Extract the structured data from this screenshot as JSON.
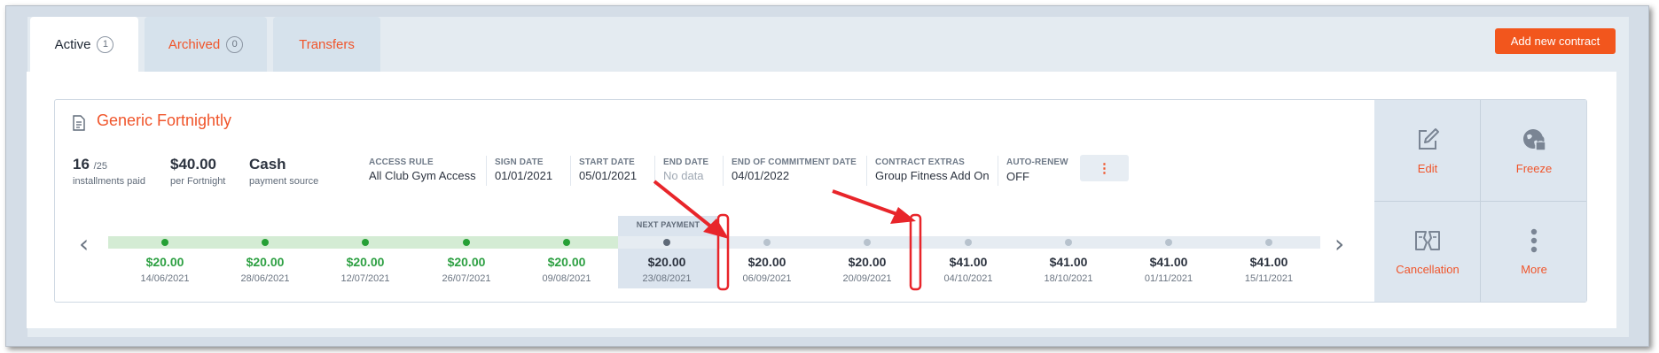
{
  "tabs": [
    {
      "label": "Active",
      "count": "1"
    },
    {
      "label": "Archived",
      "count": "0"
    },
    {
      "label": "Transfers"
    }
  ],
  "add_contract_label": "Add new contract",
  "contract": {
    "title": "Generic Fortnightly",
    "installments": {
      "value": "16",
      "total": "/25",
      "label": "installments paid"
    },
    "price": {
      "value": "$40.00",
      "label": "per Fortnight"
    },
    "payment": {
      "value": "Cash",
      "label": "payment source"
    },
    "fields": [
      {
        "label": "ACCESS RULE",
        "value": "All Club Gym Access"
      },
      {
        "label": "SIGN DATE",
        "value": "01/01/2021"
      },
      {
        "label": "START DATE",
        "value": "05/01/2021"
      },
      {
        "label": "END DATE",
        "value": "No data"
      },
      {
        "label": "END OF COMMITMENT DATE",
        "value": "04/01/2022"
      },
      {
        "label": "CONTRACT EXTRAS",
        "value": "Group Fitness Add On"
      },
      {
        "label": "AUTO-RENEW",
        "value": "OFF"
      }
    ],
    "more_fields_icon": "⋮"
  },
  "actions": [
    {
      "label": "Edit",
      "icon": "edit-icon"
    },
    {
      "label": "Freeze",
      "icon": "freeze-icon"
    },
    {
      "label": "Cancellation",
      "icon": "cancellation-icon"
    },
    {
      "label": "More",
      "icon": "more-vertical-icon"
    }
  ],
  "timeline": {
    "prev_icon": "‹",
    "next_icon": "›",
    "next_payment_label": "NEXT PAYMENT",
    "payments": [
      {
        "amount": "$20.00",
        "date": "14/06/2021",
        "status": "paid"
      },
      {
        "amount": "$20.00",
        "date": "28/06/2021",
        "status": "paid"
      },
      {
        "amount": "$20.00",
        "date": "12/07/2021",
        "status": "paid"
      },
      {
        "amount": "$20.00",
        "date": "26/07/2021",
        "status": "paid"
      },
      {
        "amount": "$20.00",
        "date": "09/08/2021",
        "status": "paid"
      },
      {
        "amount": "$20.00",
        "date": "23/08/2021",
        "status": "next"
      },
      {
        "amount": "$20.00",
        "date": "06/09/2021",
        "status": "upcoming"
      },
      {
        "amount": "$20.00",
        "date": "20/09/2021",
        "status": "upcoming"
      },
      {
        "amount": "$41.00",
        "date": "04/10/2021",
        "status": "upcoming"
      },
      {
        "amount": "$41.00",
        "date": "18/10/2021",
        "status": "upcoming"
      },
      {
        "amount": "$41.00",
        "date": "01/11/2021",
        "status": "upcoming"
      },
      {
        "amount": "$41.00",
        "date": "15/11/2021",
        "status": "upcoming"
      }
    ]
  },
  "colors": {
    "accent": "#f0552b",
    "paid": "#2ea043",
    "paid_dot": "#25a035",
    "next_dot": "#5f6a78",
    "upcoming_dot": "#b7c2cd",
    "annotation": "#e8252a"
  }
}
